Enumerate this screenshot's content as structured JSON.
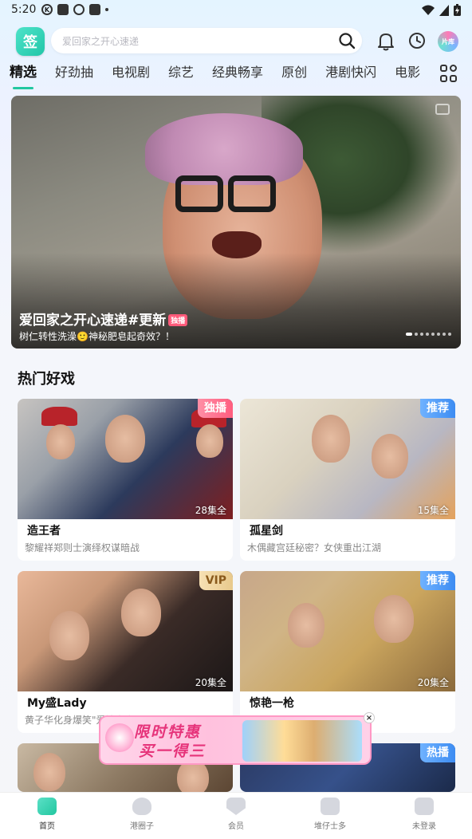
{
  "status_bar": {
    "time": "5:20",
    "k_icon": "K"
  },
  "header": {
    "logo_text": "签",
    "search_placeholder": "爱回家之开心速递",
    "library_label": "片库"
  },
  "tabs": [
    "精选",
    "好劲抽",
    "电视剧",
    "综艺",
    "经典畅享",
    "原创",
    "港剧快闪",
    "电影"
  ],
  "banner": {
    "title": "爱回家之开心速递#更新",
    "badge": "独播",
    "subtitle": "树仁转性洗澡🙂神秘肥皂起奇效？！"
  },
  "section": {
    "title": "热门好戏"
  },
  "cards": [
    {
      "title": "造王者",
      "desc": "黎耀祥郑则士演绎权谋暗战",
      "episodes": "28集全",
      "tag": "独播"
    },
    {
      "title": "孤星剑",
      "desc": "木偶藏宫廷秘密？女侠重出江湖",
      "episodes": "15集全",
      "tag": "推荐"
    },
    {
      "title": "My盛Lady",
      "desc": "黄子华化身爆笑\"爱情专家\"",
      "episodes": "20集全",
      "tag": "VIP"
    },
    {
      "title": "惊艳一枪",
      "desc": "",
      "episodes": "20集全",
      "tag": "推荐"
    },
    {
      "title": "",
      "desc": "",
      "episodes": "",
      "tag": ""
    },
    {
      "title": "",
      "desc": "",
      "episodes": "",
      "tag": "热播"
    }
  ],
  "promo": {
    "line1": "限时特惠",
    "line2": "买一得三",
    "close": "×"
  },
  "bottom_nav": [
    {
      "label": "首页",
      "active": true
    },
    {
      "label": "港圈子",
      "active": false
    },
    {
      "label": "会员",
      "active": false
    },
    {
      "label": "堆仔士多",
      "active": false
    },
    {
      "label": "未登录",
      "active": false
    }
  ],
  "colors": {
    "accent": "#22c7a0",
    "exclusive": "#ff5d7f",
    "recommend": "#3d8cf2"
  }
}
